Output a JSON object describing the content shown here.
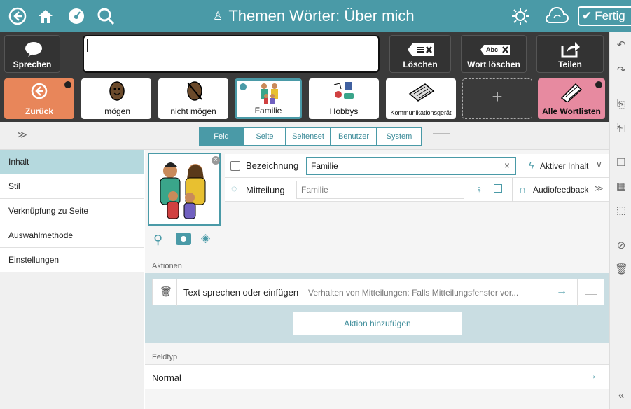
{
  "topbar": {
    "title": "Themen Wörter: Über mich",
    "done_label": "Fertig",
    "bg_color": "#4a9aa7",
    "icons": [
      "back-icon",
      "home-icon",
      "dashboard-icon",
      "search-icon",
      "light-icon",
      "sync-icon"
    ]
  },
  "message_row": {
    "speak_label": "Sprechen",
    "clear_label": "Löschen",
    "clear_icon_text": "Abc",
    "delete_word_label": "Wort löschen",
    "share_label": "Teilen"
  },
  "word_row": {
    "items": [
      {
        "label": "Zurück"
      },
      {
        "label": "mögen"
      },
      {
        "label": "nicht mögen"
      },
      {
        "label": "Familie"
      },
      {
        "label": "Hobbys"
      },
      {
        "label": "Kommunikationsgerät"
      },
      {
        "label": "+"
      },
      {
        "label": "Alle Wortlisten"
      }
    ]
  },
  "tabs": {
    "items": [
      {
        "label": "Feld"
      },
      {
        "label": "Seite"
      },
      {
        "label": "Seitenset"
      },
      {
        "label": "Benutzer"
      },
      {
        "label": "System"
      }
    ],
    "active": "Feld"
  },
  "sidebar": {
    "items": [
      {
        "label": "Inhalt"
      },
      {
        "label": "Stil"
      },
      {
        "label": "Verknüpfung zu Seite"
      },
      {
        "label": "Auswahlmethode"
      },
      {
        "label": "Einstellungen"
      }
    ],
    "selected": "Inhalt"
  },
  "content": {
    "label_name": "Bezeichnung",
    "label_value": "Familie",
    "clear_x": "×",
    "active_content": "Aktiver Inhalt",
    "message_name": "Mitteilung",
    "message_placeholder": "Familie",
    "audio_feedback": "Audiofeedback"
  },
  "actions": {
    "section_title": "Aktionen",
    "action_title": "Text sprechen oder einfügen",
    "action_desc": "Verhalten von Mitteilungen: Falls Mitteilungsfenster vor...",
    "add_action": "Aktion hinzufügen"
  },
  "fieldtype": {
    "section_title": "Feldtyp",
    "value": "Normal"
  }
}
